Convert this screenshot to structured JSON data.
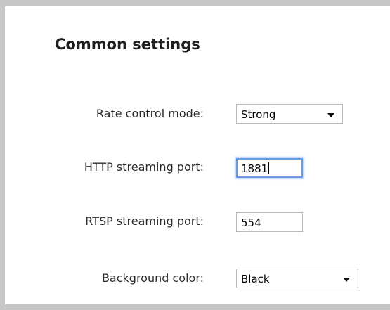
{
  "section": {
    "title": "Common settings"
  },
  "fields": {
    "rate_control": {
      "label": "Rate control mode:",
      "value": "Strong"
    },
    "http_port": {
      "label": "HTTP streaming port:",
      "value": "1881"
    },
    "rtsp_port": {
      "label": "RTSP streaming port:",
      "value": "554"
    },
    "background_color": {
      "label": "Background color:",
      "value": "Black"
    }
  },
  "colors": {
    "panel_border": "#c6c6c6",
    "input_border": "#b9b9b9",
    "focus_border": "#6a9be0"
  },
  "icons": {
    "dropdown": "chevron-down-icon"
  }
}
